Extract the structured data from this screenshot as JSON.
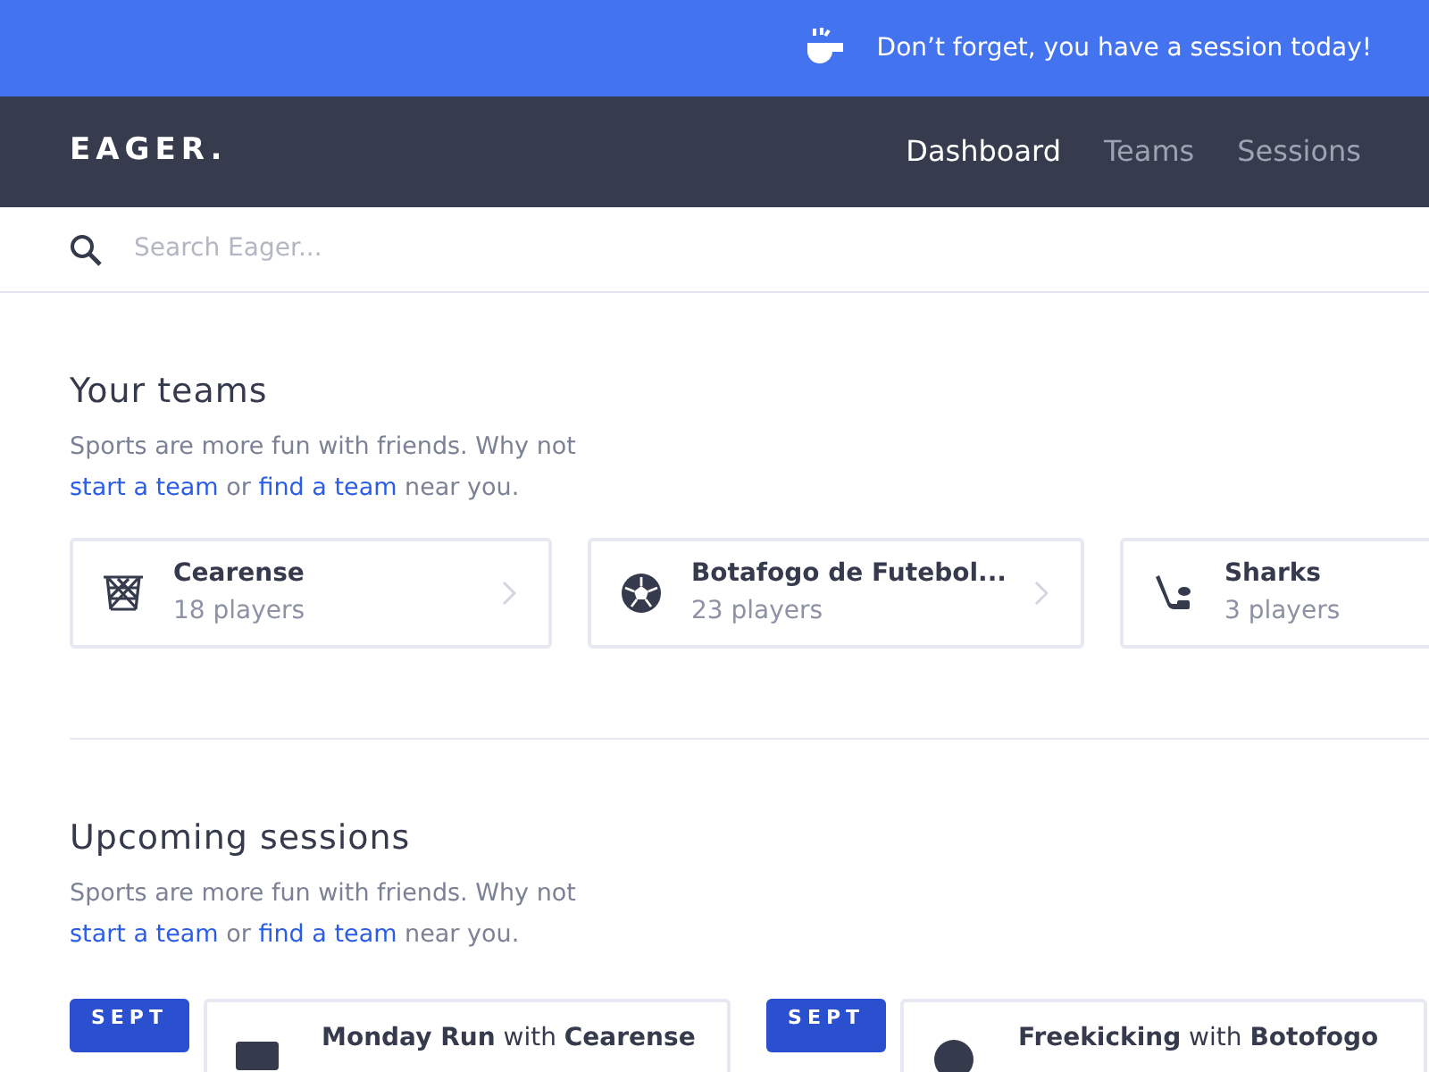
{
  "banner": {
    "text": "Don’t forget, you have a session today!"
  },
  "navbar": {
    "brand": "EAGER.",
    "links": [
      {
        "label": "Dashboard",
        "selected": true
      },
      {
        "label": "Teams",
        "selected": false
      },
      {
        "label": "Sessions",
        "selected": false
      }
    ]
  },
  "search": {
    "placeholder": "Search Eager..."
  },
  "teams_section": {
    "title": "Your teams",
    "description": [
      {
        "kind": "text",
        "text": "Sports are more fun with friends. Why not "
      },
      {
        "kind": "link",
        "text": "start a team"
      },
      {
        "kind": "text",
        "text": " or "
      },
      {
        "kind": "link",
        "text": "find a team"
      },
      {
        "kind": "text",
        "text": " near you."
      }
    ],
    "teams": [
      {
        "kind": "basketball",
        "name": "Cearense",
        "players": "18 players",
        "chevron": true
      },
      {
        "kind": "soccer",
        "name": "Botafogo de Futebol...",
        "players": "23 players",
        "chevron": true
      },
      {
        "kind": "hockey",
        "name": "Sharks",
        "players": "3 players",
        "chevron": false
      }
    ]
  },
  "sessions_section": {
    "title": "Upcoming sessions",
    "description": [
      {
        "kind": "text",
        "text": "Sports are more fun with friends. Why not "
      },
      {
        "kind": "link",
        "text": "start a team"
      },
      {
        "kind": "text",
        "text": " or "
      },
      {
        "kind": "link",
        "text": "find a team"
      },
      {
        "kind": "text",
        "text": " near you."
      }
    ],
    "sessions": [
      {
        "kind": "run",
        "month": "SEPT",
        "title": "**Monday Run** with **Cearense**"
      },
      {
        "kind": "ball",
        "month": "SEPT",
        "title": "**Freekicking** with **Botofogo**"
      }
    ]
  }
}
